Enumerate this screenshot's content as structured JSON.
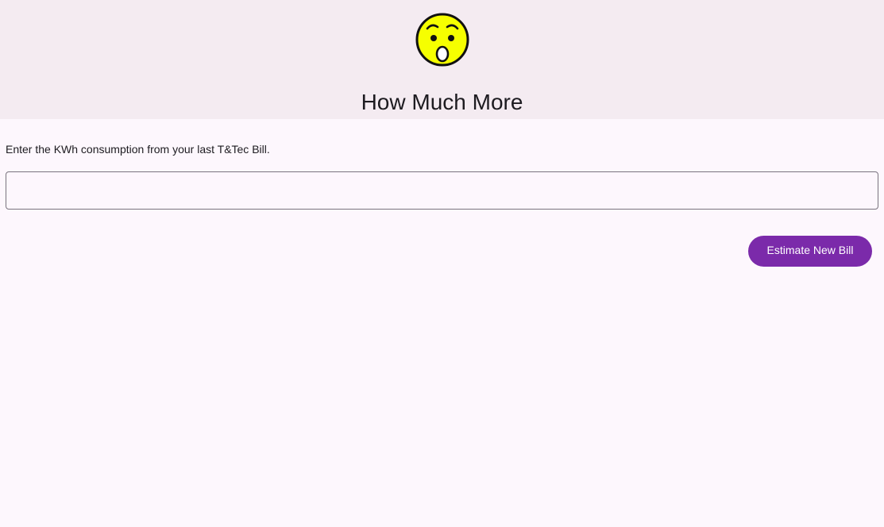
{
  "header": {
    "logo_icon": "astonished-face-icon",
    "title": "How Much More"
  },
  "main": {
    "instruction": "Enter the KWh consumption from your last T&Tec Bill.",
    "kwh_input": {
      "value": "",
      "placeholder": ""
    },
    "estimate_button_label": "Estimate New Bill"
  },
  "colors": {
    "header_background": "#f4ebf1",
    "page_background": "#fdf7fd",
    "accent": "#7b2aaa",
    "emoji_face": "#f6ff00"
  }
}
